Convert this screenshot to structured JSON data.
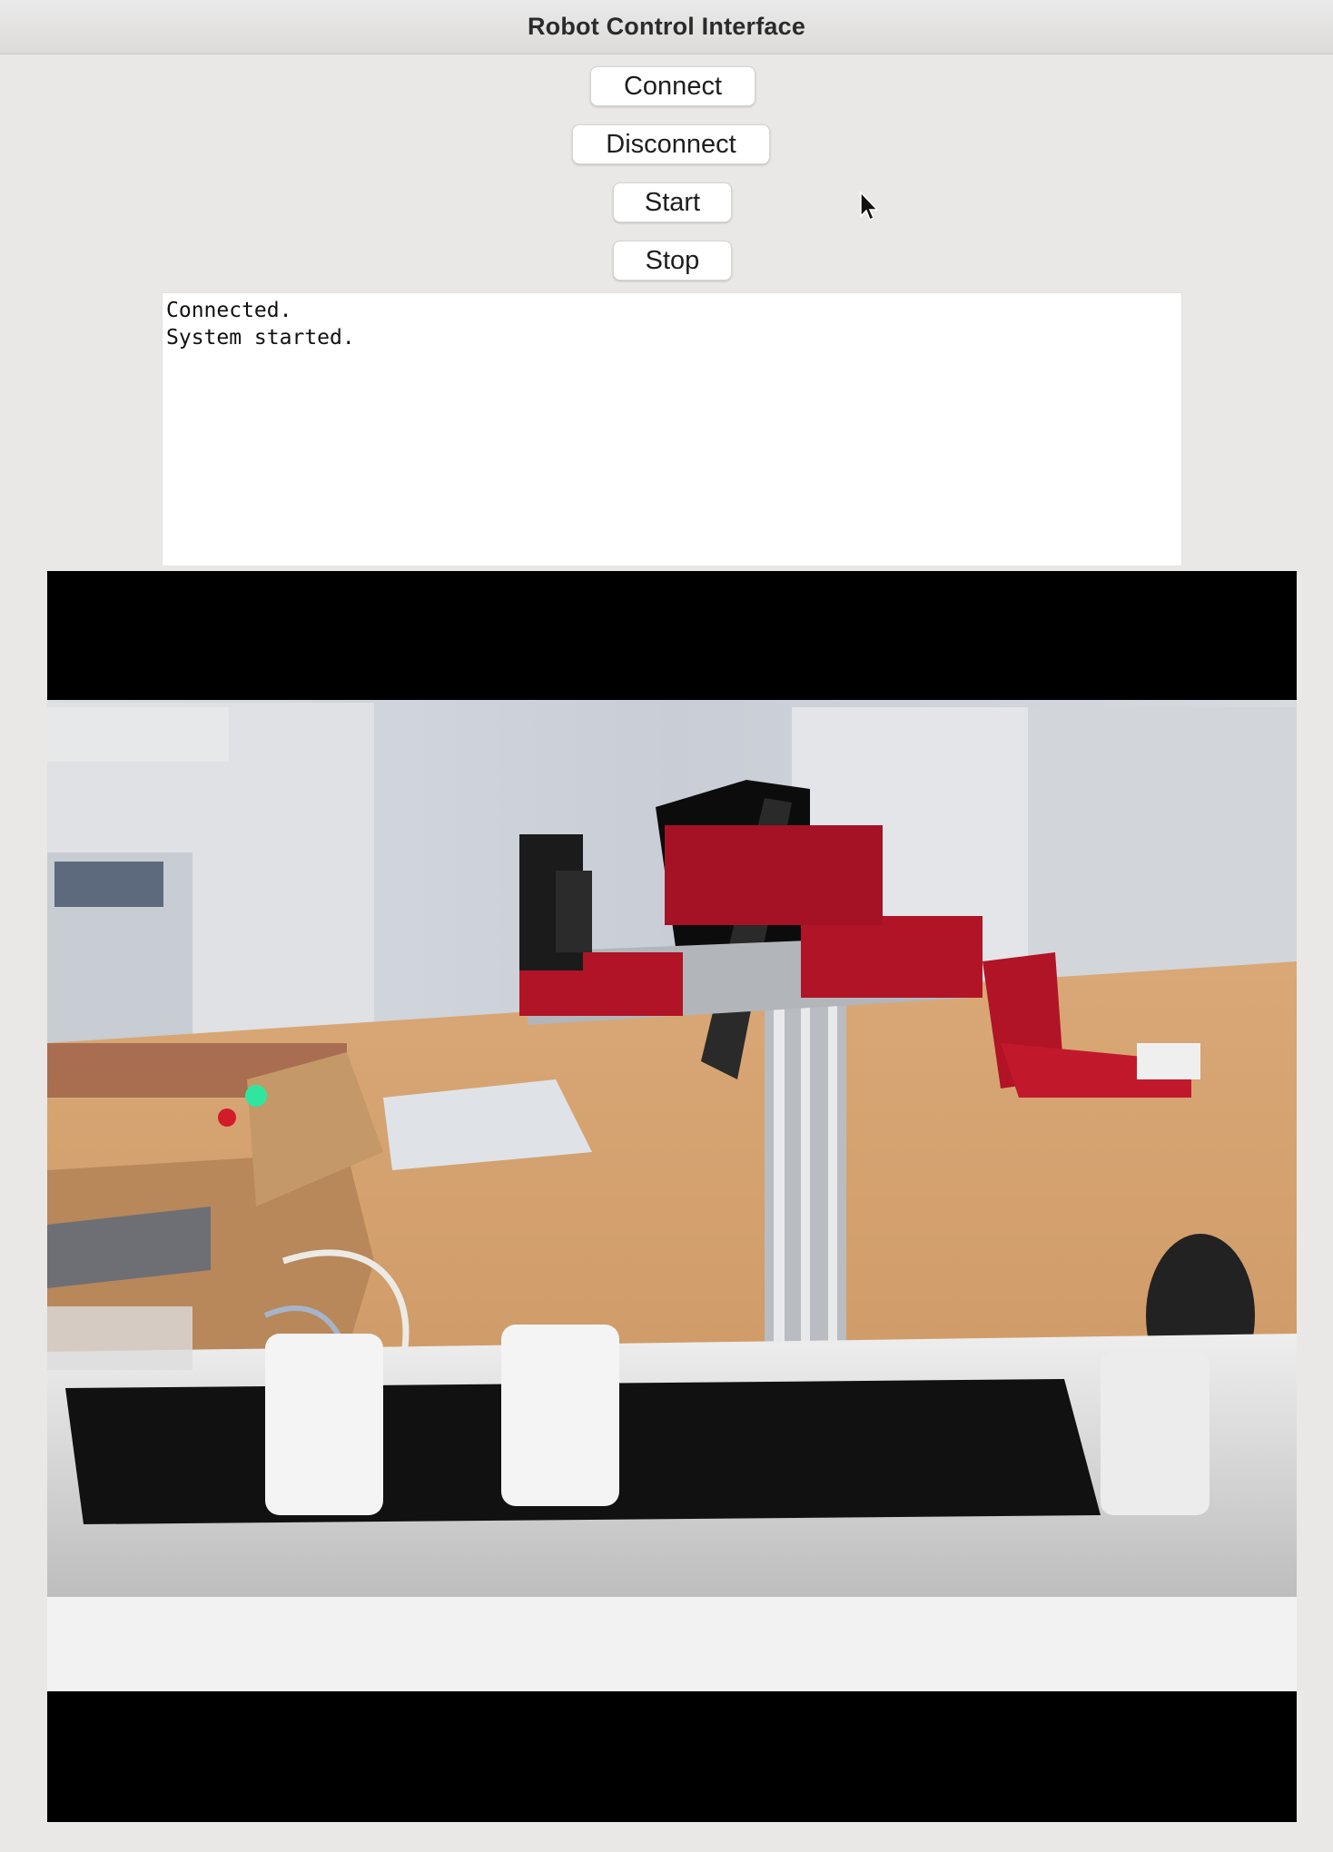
{
  "window": {
    "title": "Robot Control Interface"
  },
  "controls": {
    "connect_label": "Connect",
    "disconnect_label": "Disconnect",
    "start_label": "Start",
    "stop_label": "Stop"
  },
  "log": {
    "lines": [
      "Connected.",
      "System started."
    ]
  },
  "video": {
    "description_icon": "camera-feed",
    "letterbox_color": "#000000"
  },
  "colors": {
    "window_bg": "#e9e8e6",
    "button_bg": "#ffffff",
    "robot_red": "#c0142a"
  }
}
